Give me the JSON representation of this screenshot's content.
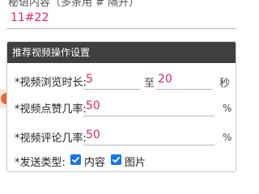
{
  "top_field": {
    "label": "秘语内容（多条用 # 隔开）",
    "value": "11#22"
  },
  "section": {
    "title": "推荐视频操作设置"
  },
  "browse_time": {
    "label": "*视频浏览时长:",
    "min": "5",
    "to": "至",
    "max": "20",
    "unit": "秒"
  },
  "like_rate": {
    "label": "*视频点赞几率:",
    "value": "50",
    "unit": "%"
  },
  "comment_rate": {
    "label": "*视频评论几率:",
    "value": "50",
    "unit": "%"
  },
  "send_type": {
    "label": "*发送类型:",
    "options": [
      {
        "label": "内容",
        "checked": true
      },
      {
        "label": "图片",
        "checked": true
      }
    ]
  },
  "colors": {
    "accent": "#e0245e",
    "header_bg": "#3f3f3f",
    "checkbox": "#1a73e8"
  }
}
